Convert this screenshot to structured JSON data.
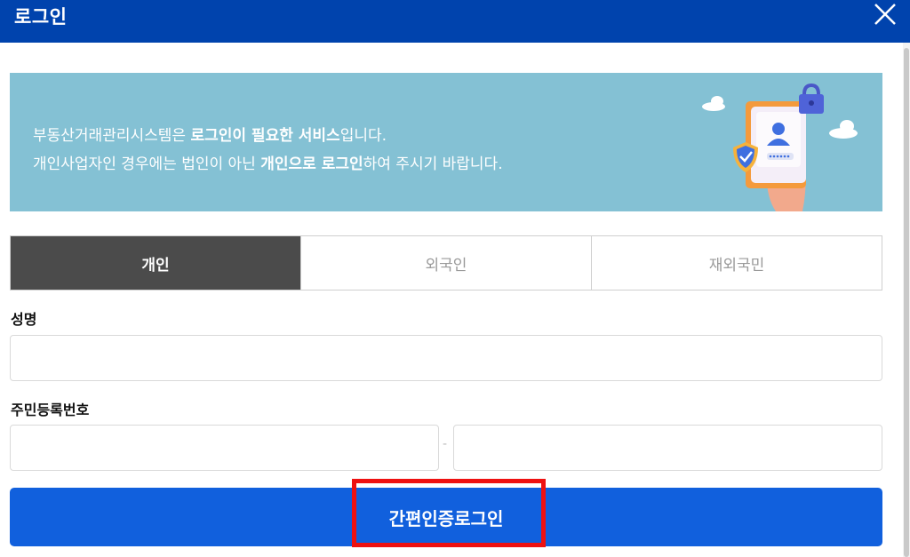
{
  "window": {
    "title": "로그인"
  },
  "banner": {
    "line1_a": "부동산거래관리시스템은 ",
    "line1_b": "로그인이 필요한 서비스",
    "line1_c": "입니다.",
    "line2_a": "개인사업자인 경우에는 법인이 아닌 ",
    "line2_b": "개인으로 로그인",
    "line2_c": "하여 주시기 바랍니다."
  },
  "tabs": [
    {
      "label": "개인",
      "active": true
    },
    {
      "label": "외국인",
      "active": false
    },
    {
      "label": "재외국민",
      "active": false
    }
  ],
  "form": {
    "name_label": "성명",
    "name_value": "",
    "rrn_label": "주민등록번호",
    "rrn_front_value": "",
    "rrn_back_value": "",
    "rrn_separator": "-"
  },
  "login_button": {
    "label": "간편인증로그인"
  },
  "colors": {
    "titlebar": "#0043ad",
    "banner": "#84c1d4",
    "tab_active": "#4b4b4b",
    "button": "#1160dd",
    "highlight": "#ee1111"
  },
  "icons": {
    "close": "close-icon",
    "illustration": "login-security-illustration"
  }
}
